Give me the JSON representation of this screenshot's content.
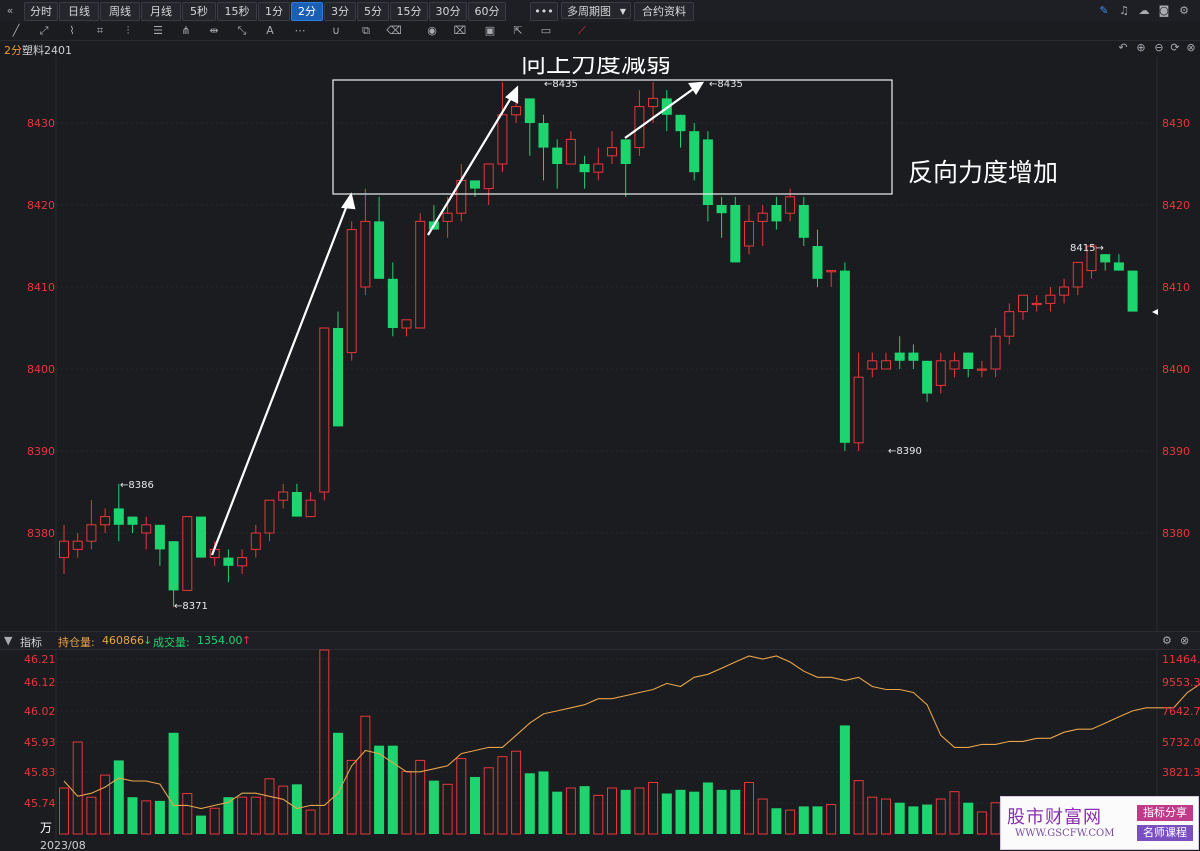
{
  "toolbar": {
    "back_icon": "double-chevron-left-icon",
    "periods": [
      "分时",
      "日线",
      "周线",
      "月线",
      "5秒",
      "15秒",
      "1分",
      "2分",
      "3分",
      "5分",
      "15分",
      "30分",
      "60分"
    ],
    "active_period": "2分",
    "more_label": "•••",
    "multi_period_label": "多周期图",
    "contract_info_label": "合约资料",
    "right_icons": [
      "pen-icon",
      "bell-icon",
      "cloud-icon",
      "camera-icon",
      "settings-icon",
      "expand-icon"
    ],
    "draw_tools": [
      "line-tool-icon",
      "ray-tool-icon",
      "polyline-icon",
      "parallel-lines-icon",
      "fib-icon",
      "gann-fan-icon",
      "range-icon",
      "pitchfork-icon",
      "text-tool-icon",
      "more-tools-icon",
      "magnet-icon",
      "layers-icon",
      "eraser-icon",
      "eye-icon",
      "delete-icon",
      "lock-icon",
      "export-icon",
      "comment-icon",
      "ruler-icon"
    ]
  },
  "chart_header": {
    "period": "2分",
    "symbol": "塑料2401",
    "icons": [
      "undo-icon",
      "plus-circle-icon",
      "minus-circle-icon",
      "reset-icon",
      "close-icon"
    ]
  },
  "annotations": {
    "top_text": "向上力度减弱",
    "right_text": "反向力度增加"
  },
  "price_axis": {
    "ticks": [
      "8430",
      "8420",
      "8410",
      "8400",
      "8390",
      "8380"
    ],
    "color": "#e8363a"
  },
  "price_labels": {
    "high1": "8386",
    "low1": "8371",
    "peak_a": "8435",
    "peak_b": "8435",
    "low2": "8390",
    "high2": "8415"
  },
  "indicator_bar": {
    "label": "指标",
    "open_interest_label": "持仓量:",
    "open_interest_value": "460866",
    "volume_label": "成交量:",
    "volume_value": "1354.00",
    "down_arrow": "↓",
    "up_arrow": "↑"
  },
  "volume_axis": {
    "left_ticks": [
      "46.21",
      "46.12",
      "46.02",
      "45.93",
      "45.83",
      "45.74"
    ],
    "right_ticks": [
      "11464.0",
      "9553.3",
      "7642.7",
      "5732.0",
      "3821.3"
    ],
    "unit": "万",
    "date": "2023/08"
  },
  "watermark": {
    "main": "股市财富网",
    "url": "WWW.GSCFW.COM",
    "tag1": "指标分享",
    "tag2": "名师课程"
  },
  "colors": {
    "up": "#e8363a",
    "down": "#1ed46e",
    "background": "#1b1c20",
    "oi_line": "#e8a44a",
    "annotation": "#ffffff"
  },
  "chart_data": {
    "type": "candlestick",
    "price_ylim": [
      8368,
      8438
    ],
    "candles": [
      [
        8377,
        8379,
        8381,
        8375
      ],
      [
        8378,
        8379,
        8380,
        8377
      ],
      [
        8379,
        8381,
        8384,
        8378
      ],
      [
        8381,
        8382,
        8383,
        8380
      ],
      [
        8383,
        8381,
        8386,
        8379
      ],
      [
        8382,
        8381,
        8382,
        8380
      ],
      [
        8380,
        8381,
        8382,
        8378
      ],
      [
        8381,
        8378,
        8381,
        8376
      ],
      [
        8379,
        8373,
        8379,
        8371
      ],
      [
        8373,
        8382,
        8382,
        8373
      ],
      [
        8382,
        8377,
        8382,
        8377
      ],
      [
        8377,
        8378,
        8379,
        8376
      ],
      [
        8377,
        8376,
        8378,
        8374
      ],
      [
        8376,
        8377,
        8378,
        8375
      ],
      [
        8378,
        8380,
        8381,
        8377
      ],
      [
        8380,
        8384,
        8384,
        8379
      ],
      [
        8384,
        8385,
        8386,
        8383
      ],
      [
        8385,
        8382,
        8386,
        8382
      ],
      [
        8382,
        8384,
        8385,
        8382
      ],
      [
        8385,
        8405,
        8405,
        8384
      ],
      [
        8405,
        8393,
        8407,
        8393
      ],
      [
        8402,
        8417,
        8418,
        8401
      ],
      [
        8410,
        8418,
        8422,
        8409
      ],
      [
        8418,
        8411,
        8421,
        8411
      ],
      [
        8411,
        8405,
        8413,
        8404
      ],
      [
        8405,
        8406,
        8406,
        8404
      ],
      [
        8405,
        8418,
        8419,
        8405
      ],
      [
        8418,
        8417,
        8420,
        8417
      ],
      [
        8418,
        8419,
        8421,
        8416
      ],
      [
        8419,
        8423,
        8425,
        8418
      ],
      [
        8423,
        8422,
        8423,
        8421
      ],
      [
        8422,
        8425,
        8425,
        8420
      ],
      [
        8425,
        8431,
        8435,
        8424
      ],
      [
        8431,
        8432,
        8433,
        8430
      ],
      [
        8433,
        8430,
        8433,
        8426
      ],
      [
        8430,
        8427,
        8431,
        8423
      ],
      [
        8427,
        8425,
        8428,
        8422
      ],
      [
        8425,
        8428,
        8429,
        8425
      ],
      [
        8425,
        8424,
        8426,
        8422
      ],
      [
        8424,
        8425,
        8427,
        8423
      ],
      [
        8426,
        8427,
        8429,
        8425
      ],
      [
        8428,
        8425,
        8428,
        8421
      ],
      [
        8427,
        8432,
        8434,
        8426
      ],
      [
        8432,
        8433,
        8435,
        8430
      ],
      [
        8433,
        8431,
        8434,
        8429
      ],
      [
        8431,
        8429,
        8431,
        8427
      ],
      [
        8429,
        8424,
        8430,
        8423
      ],
      [
        8428,
        8420,
        8429,
        8418
      ],
      [
        8420,
        8419,
        8421,
        8416
      ],
      [
        8420,
        8413,
        8421,
        8413
      ],
      [
        8415,
        8418,
        8420,
        8414
      ],
      [
        8418,
        8419,
        8420,
        8415
      ],
      [
        8420,
        8418,
        8421,
        8417
      ],
      [
        8419,
        8421,
        8422,
        8418
      ],
      [
        8420,
        8416,
        8421,
        8415
      ],
      [
        8415,
        8411,
        8417,
        8410
      ],
      [
        8412,
        8412,
        8412,
        8410
      ],
      [
        8412,
        8391,
        8413,
        8390
      ],
      [
        8391,
        8399,
        8402,
        8390
      ],
      [
        8400,
        8401,
        8402,
        8399
      ],
      [
        8400,
        8401,
        8402,
        8400
      ],
      [
        8402,
        8401,
        8404,
        8400
      ],
      [
        8402,
        8401,
        8403,
        8400
      ],
      [
        8401,
        8397,
        8401,
        8396
      ],
      [
        8398,
        8401,
        8402,
        8397
      ],
      [
        8400,
        8401,
        8402,
        8399
      ],
      [
        8402,
        8400,
        8402,
        8399
      ],
      [
        8400,
        8400,
        8401,
        8399
      ],
      [
        8400,
        8404,
        8405,
        8399
      ],
      [
        8404,
        8407,
        8408,
        8403
      ],
      [
        8407,
        8409,
        8409,
        8406
      ],
      [
        8408,
        8408,
        8409,
        8407
      ],
      [
        8408,
        8409,
        8410,
        8407
      ],
      [
        8409,
        8410,
        8411,
        8408
      ],
      [
        8410,
        8413,
        8413,
        8409
      ],
      [
        8412,
        8415,
        8415,
        8411
      ],
      [
        8414,
        8413,
        8414,
        8412
      ],
      [
        8413,
        8412,
        8414,
        8412
      ],
      [
        8412,
        8407,
        8412,
        8407
      ]
    ],
    "volume_ratio": [
      0.25,
      0.5,
      0.2,
      0.32,
      0.4,
      0.2,
      0.18,
      0.18,
      0.55,
      0.22,
      0.1,
      0.14,
      0.2,
      0.2,
      0.2,
      0.3,
      0.26,
      0.27,
      0.13,
      1.0,
      0.55,
      0.4,
      0.64,
      0.48,
      0.48,
      0.34,
      0.4,
      0.29,
      0.27,
      0.41,
      0.31,
      0.36,
      0.42,
      0.45,
      0.33,
      0.34,
      0.23,
      0.25,
      0.26,
      0.21,
      0.25,
      0.24,
      0.25,
      0.28,
      0.22,
      0.24,
      0.23,
      0.28,
      0.24,
      0.24,
      0.28,
      0.19,
      0.14,
      0.13,
      0.15,
      0.15,
      0.16,
      0.59,
      0.29,
      0.2,
      0.19,
      0.17,
      0.15,
      0.16,
      0.19,
      0.23,
      0.17,
      0.12,
      0.17,
      0.13,
      0.16,
      0.15,
      0.17,
      0.12,
      0.11,
      0.17,
      0.2,
      0.16,
      0.11
    ],
    "open_interest": [
      45.81,
      45.76,
      45.77,
      45.79,
      45.82,
      45.81,
      45.81,
      45.8,
      45.73,
      45.73,
      45.72,
      45.73,
      45.74,
      45.77,
      45.77,
      45.76,
      45.75,
      45.72,
      45.73,
      45.73,
      45.77,
      45.86,
      45.91,
      45.9,
      45.87,
      45.84,
      45.84,
      45.85,
      45.86,
      45.9,
      45.91,
      45.92,
      45.92,
      45.96,
      46.0,
      46.03,
      46.04,
      46.05,
      46.06,
      46.08,
      46.08,
      46.09,
      46.1,
      46.11,
      46.13,
      46.12,
      46.15,
      46.16,
      46.18,
      46.2,
      46.22,
      46.21,
      46.22,
      46.2,
      46.17,
      46.15,
      46.15,
      46.14,
      46.15,
      46.12,
      46.11,
      46.11,
      46.1,
      46.06,
      45.96,
      45.92,
      45.92,
      45.93,
      45.93,
      45.94,
      45.94,
      45.95,
      45.95,
      45.97,
      45.98,
      45.98,
      46.0,
      46.02,
      46.04,
      46.05,
      46.05,
      46.05,
      46.1,
      46.13,
      46.13,
      46.1
    ]
  }
}
